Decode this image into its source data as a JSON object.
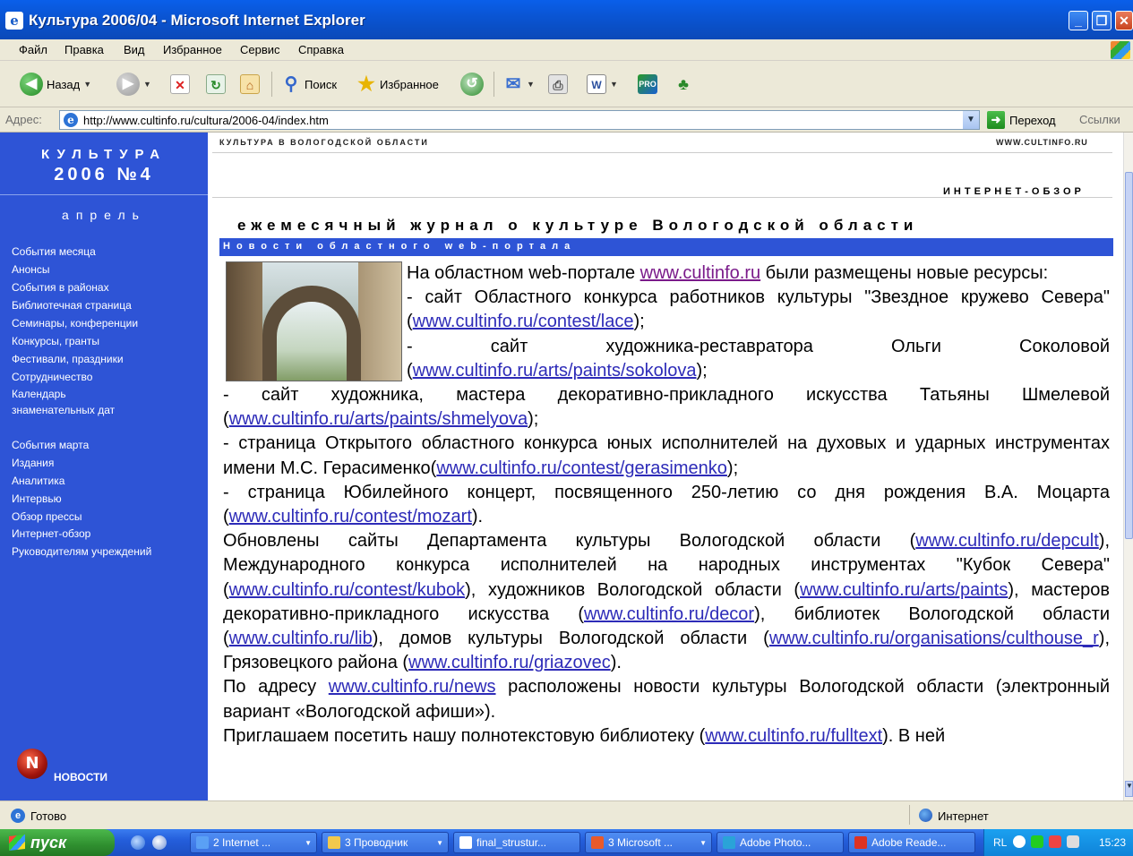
{
  "window": {
    "title": "Культура 2006/04 - Microsoft Internet Explorer"
  },
  "menu": [
    "Файл",
    "Правка",
    "Вид",
    "Избранное",
    "Сервис",
    "Справка"
  ],
  "toolbar": {
    "back": "Назад",
    "search": "Поиск",
    "favorites": "Избранное"
  },
  "address": {
    "label": "Адрес:",
    "url": "http://www.cultinfo.ru/cultura/2006-04/index.htm",
    "go": "Переход",
    "links": "Ссылки"
  },
  "sidebar": {
    "title1": "КУЛЬТУРА",
    "title2": "2006 №4",
    "month": "апрель",
    "links": [
      "События месяца",
      "Анонсы",
      "События в районах",
      "Библиотечная страница",
      "Семинары, конференции",
      "Конкурсы, гранты",
      "Фестивали, праздники",
      "Сотрудничество",
      "Календарь",
      "знаменательных дат"
    ],
    "links2": [
      "События марта",
      "Издания",
      "Аналитика",
      "Интервью",
      "Обзор прессы",
      "Интернет-обзор",
      "Руководителям учреждений"
    ],
    "news": "НОВОСТИ"
  },
  "header": {
    "top_left": "КУЛЬТУРА В ВОЛОГОДСКОЙ ОБЛАСТИ",
    "top_right": "WWW.CULTINFO.RU",
    "section": "ИНТЕРНЕТ-ОБЗОР",
    "journal": "ежемесячный журнал о культуре Вологодской области",
    "strip": "Новости областного web-портала"
  },
  "article": {
    "p1_a": "На областном web-портале ",
    "l_cultinfo": "www.cultinfo.ru",
    "p1_b": " были размещены новые ресурсы:",
    "i1_a": "- сайт Областного конкурса работников культуры \"Звездное кружево Севера\" (",
    "l_lace": "www.cultinfo.ru/contest/lace",
    "i1_b": ");",
    "i2_a": "- сайт художника-реставратора Ольги Соколовой (",
    "l_sokolova": "www.cultinfo.ru/arts/paints/sokolova",
    "i2_b": ");",
    "i3_a": "- сайт художника, мастера декоративно-прикладного искусства Татьяны Шмелевой (",
    "l_shmelyova": "www.cultinfo.ru/arts/paints/shmelyova",
    "i3_b": ");",
    "i4_a": "- страница Открытого областного конкурса юных исполнителей на духовых и ударных инструментах имени М.С. Герасименко(",
    "l_gerasimenko": "www.cultinfo.ru/contest/gerasimenko",
    "i4_b": ");",
    "i5_a": "- страница Юбилейного концерт, посвященного 250-летию со дня рождения В.А. Моцарта (",
    "l_mozart": "www.cultinfo.ru/contest/mozart",
    "i5_b": ").",
    "p2_a": "Обновлены сайты Департамента культуры Вологодской области (",
    "l_depcult": "www.cultinfo.ru/depcult",
    "p2_b": "), Международного конкурса исполнителей на народных инструментах \"Кубок Севера\" (",
    "l_kubok": "www.cultinfo.ru/contest/kubok",
    "p2_c": "), художников Вологодской области (",
    "l_paints": "www.cultinfo.ru/arts/paints",
    "p2_d": "), мастеров декоративно-прикладного искусства (",
    "l_decor": "www.cultinfo.ru/decor",
    "p2_e": "), библиотек Вологодской области (",
    "l_lib": "www.cultinfo.ru/lib",
    "p2_f": "), домов культуры Вологодской области (",
    "l_culthouse": "www.cultinfo.ru/organisations/culthouse_r",
    "p2_g": "), Грязовецкого района (",
    "l_griazovec": "www.cultinfo.ru/griazovec",
    "p2_h": ").",
    "p3_a": "По адресу ",
    "l_news": "www.cultinfo.ru/news",
    "p3_b": " расположены новости культуры Вологодской области (электронный вариант «Вологодской афиши»).",
    "p4_a": "Приглашаем посетить нашу полнотекстовую библиотеку (",
    "l_fulltext": "www.cultinfo.ru/fulltext",
    "p4_b": "). В ней"
  },
  "status": {
    "text": "Готово",
    "zone": "Интернет"
  },
  "taskbar": {
    "start": "пуск",
    "tasks": [
      "2 Internet ...",
      "3 Проводник",
      "final_strustur...",
      "3 Microsoft ...",
      "Adobe Photo...",
      "Adobe Reade..."
    ],
    "lang": "RL",
    "clock": "15:23"
  }
}
